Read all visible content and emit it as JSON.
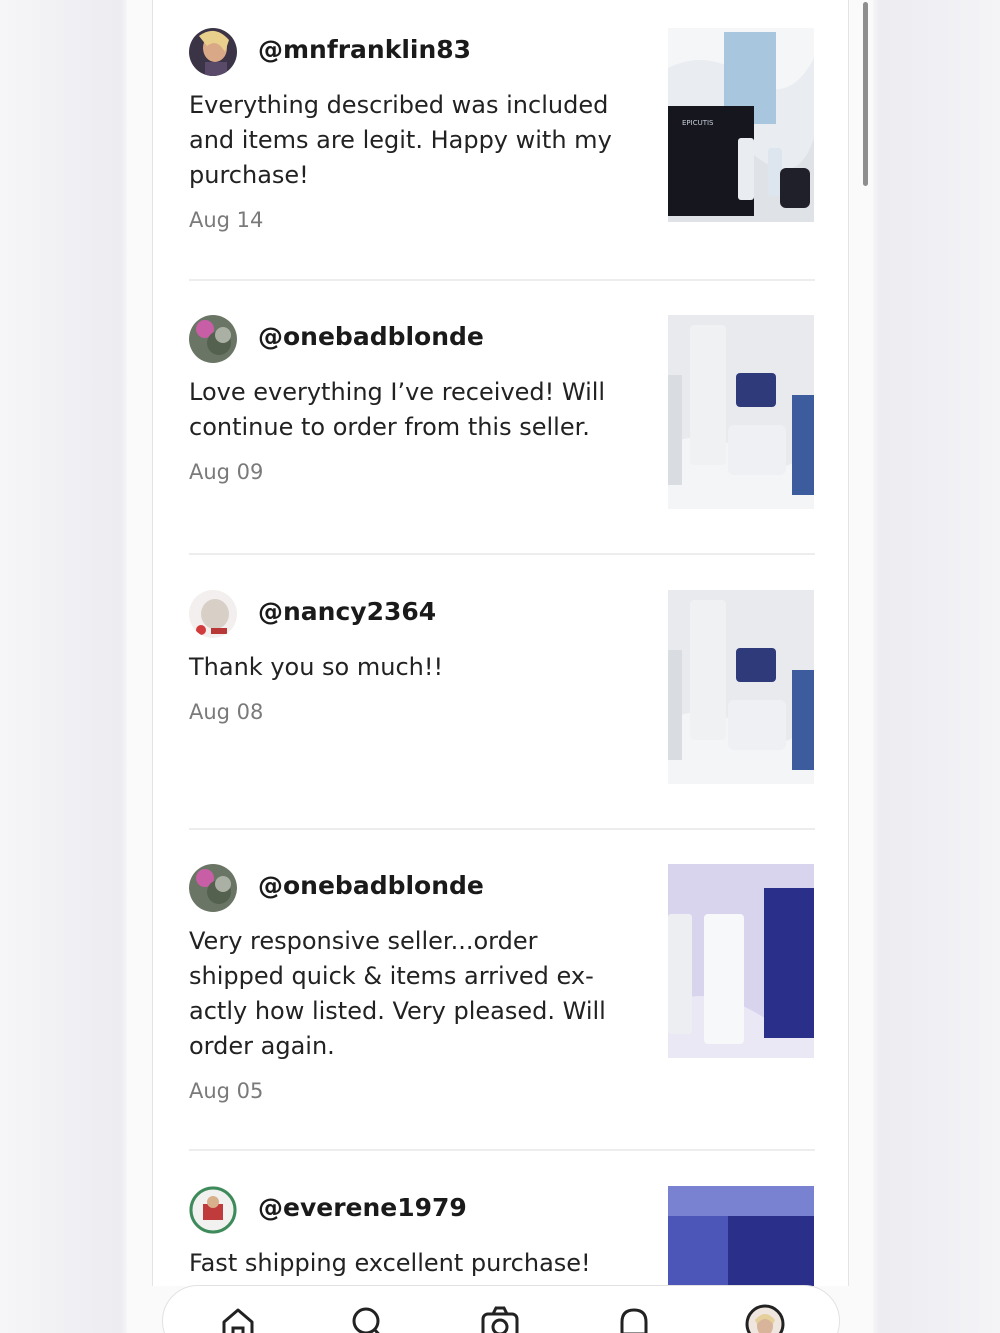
{
  "reviews": [
    {
      "username": "@mnfranklin83",
      "text": "Everything described was included and items are legit. Happy with my purchase!",
      "date": "Aug 14",
      "photo_brand": "EPICUTIS"
    },
    {
      "username": "@onebadblonde",
      "text": "Love everything I’ve received! Will continue to order from this seller.",
      "date": "Aug 09"
    },
    {
      "username": "@nancy2364",
      "text": "Thank you so much!!",
      "date": "Aug 08"
    },
    {
      "username": "@onebadblonde",
      "text": "Very responsive seller...order shipped quick & items arrived ex-actly how listed. Very pleased. Will order again.",
      "date": "Aug 05"
    },
    {
      "username": "@everene1979",
      "text": "Fast shipping excellent purchase!",
      "date": ""
    }
  ],
  "bottom_nav": [
    {
      "icon": "home-icon"
    },
    {
      "icon": "search-icon"
    },
    {
      "icon": "camera-icon"
    },
    {
      "icon": "bell-icon"
    },
    {
      "icon": "profile-avatar"
    }
  ],
  "colors": {
    "username": "#1a1a1a",
    "review_text": "#222222",
    "date": "#7a7a7a",
    "divider": "#ededed"
  }
}
